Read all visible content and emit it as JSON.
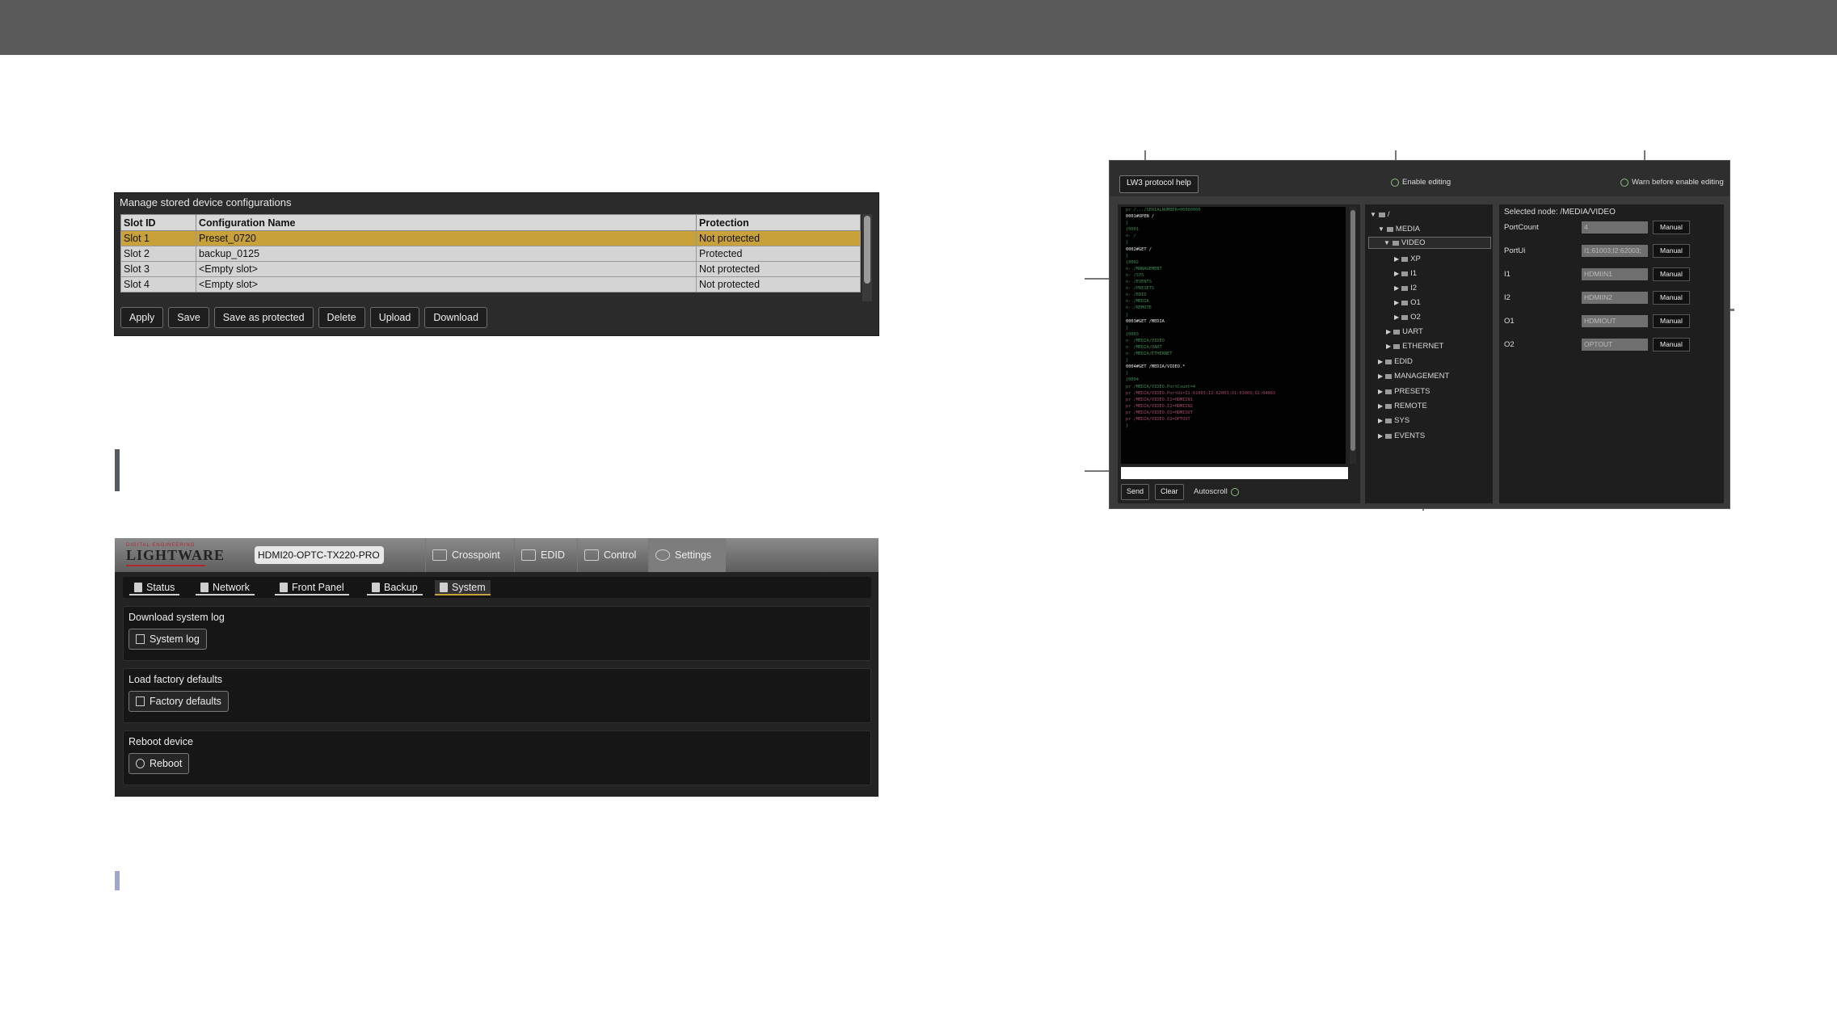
{
  "config_panel": {
    "title": "Manage stored device configurations",
    "columns": [
      "Slot ID",
      "Configuration Name",
      "Protection"
    ],
    "rows": [
      {
        "slot": "Slot 1",
        "name": "Preset_0720",
        "protection": "Not protected"
      },
      {
        "slot": "Slot 2",
        "name": "backup_0125",
        "protection": "Protected"
      },
      {
        "slot": "Slot 3",
        "name": "<Empty slot>",
        "protection": "Not protected"
      },
      {
        "slot": "Slot 4",
        "name": "<Empty slot>",
        "protection": "Not protected"
      }
    ],
    "buttons": [
      "Apply",
      "Save",
      "Save as protected",
      "Delete",
      "Upload",
      "Download"
    ],
    "selected_color": "#c8a13a"
  },
  "lightware": {
    "logo_tagline": "DIGITAL ENGINEERING",
    "logo": "LIGHTWARE",
    "device": "HDMI20-OPTC-TX220-PRO",
    "top_tabs": [
      "Crosspoint",
      "EDID",
      "Control",
      "Settings"
    ],
    "sub_tabs": [
      "Status",
      "Network",
      "Front Panel",
      "Backup",
      "System"
    ],
    "sections": [
      {
        "label": "Download system log",
        "button": "System log",
        "icon": "document-icon"
      },
      {
        "label": "Load factory defaults",
        "button": "Factory defaults",
        "icon": "reset-icon"
      },
      {
        "label": "Reboot device",
        "button": "Reboot",
        "icon": "power-icon"
      }
    ]
  },
  "lw3": {
    "help_button": "LW3 protocol help",
    "enable_editing": "Enable editing",
    "warn_before": "Warn before enable editing",
    "send": "Send",
    "clear": "Clear",
    "autoscroll": "Autoscroll",
    "tree": {
      "root": "/",
      "media": "MEDIA",
      "video": "VIDEO",
      "video_children": [
        "XP",
        "I1",
        "I2",
        "O1",
        "O2"
      ],
      "uart": "UART",
      "ethernet": "ETHERNET",
      "top_level": [
        "EDID",
        "MANAGEMENT",
        "PRESETS",
        "REMOTE",
        "SYS",
        "EVENTS"
      ]
    },
    "selected_node": "Selected node: /MEDIA/VIDEO",
    "properties": [
      {
        "name": "PortCount",
        "value": "4",
        "button": "Manual"
      },
      {
        "name": "PortUi",
        "value": "I1:61003;I2:62003;",
        "button": "Manual"
      },
      {
        "name": "I1",
        "value": "HDMIIN1",
        "button": "Manual"
      },
      {
        "name": "I2",
        "value": "HDMIIN2",
        "button": "Manual"
      },
      {
        "name": "O1",
        "value": "HDMIOUT",
        "button": "Manual"
      },
      {
        "name": "O2",
        "value": "OPTOUT",
        "button": "Manual"
      }
    ]
  }
}
